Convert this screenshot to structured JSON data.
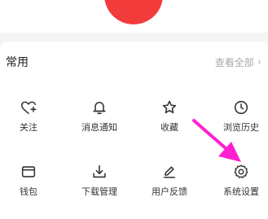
{
  "section": {
    "title": "常用",
    "see_all": "查看全部"
  },
  "items": [
    {
      "label": "关注",
      "icon": "heart-plus-icon"
    },
    {
      "label": "消息通知",
      "icon": "bell-icon"
    },
    {
      "label": "收藏",
      "icon": "star-icon"
    },
    {
      "label": "浏览历史",
      "icon": "clock-icon"
    },
    {
      "label": "钱包",
      "icon": "wallet-icon"
    },
    {
      "label": "下载管理",
      "icon": "download-icon"
    },
    {
      "label": "用户反馈",
      "icon": "feedback-edit-icon"
    },
    {
      "label": "系统设置",
      "icon": "gear-icon"
    }
  ],
  "colors": {
    "accent_red": "#f23c3c",
    "annotation_arrow": "#ff1fd1"
  }
}
